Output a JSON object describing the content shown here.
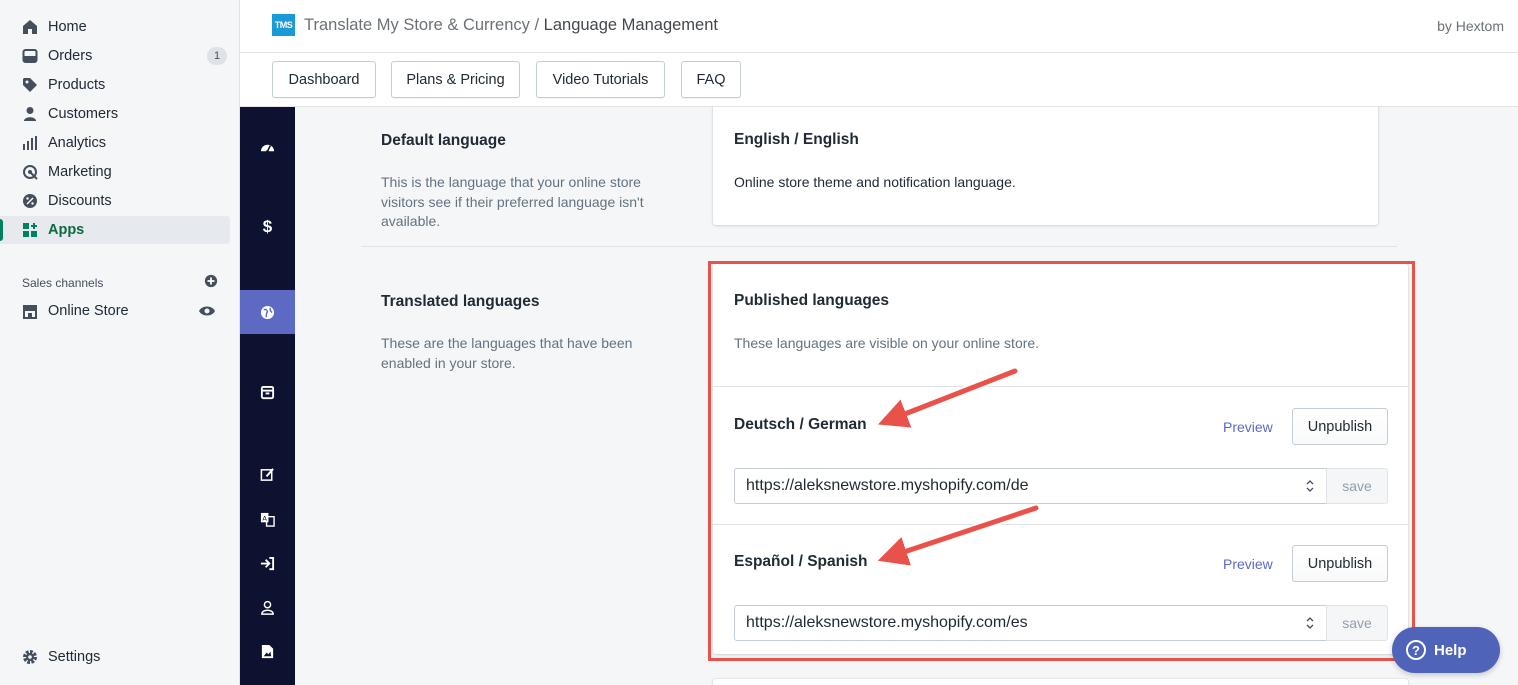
{
  "nav": {
    "items": [
      {
        "label": "Home",
        "icon": "home-icon"
      },
      {
        "label": "Orders",
        "icon": "orders-icon",
        "badge": "1"
      },
      {
        "label": "Products",
        "icon": "tag-icon"
      },
      {
        "label": "Customers",
        "icon": "person-icon"
      },
      {
        "label": "Analytics",
        "icon": "bar-chart-icon"
      },
      {
        "label": "Marketing",
        "icon": "megaphone-icon"
      },
      {
        "label": "Discounts",
        "icon": "discount-icon"
      },
      {
        "label": "Apps",
        "icon": "apps-icon",
        "active": true
      }
    ],
    "sales_channels_label": "Sales channels",
    "online_store_label": "Online Store",
    "settings_label": "Settings"
  },
  "header": {
    "logo_text": "TMS",
    "app_name": "Translate My Store & Currency",
    "separator": "/",
    "page_name": "Language Management",
    "by": "by Hextom"
  },
  "tabs": [
    "Dashboard",
    "Plans & Pricing",
    "Video Tutorials",
    "FAQ"
  ],
  "app_sidebar_icons": [
    "dashboard-icon",
    "dollar-icon",
    "globe-icon",
    "archive-icon",
    "edit-icon",
    "translate-icon",
    "sign-in-icon",
    "user-icon",
    "image-icon"
  ],
  "default_language": {
    "title": "Default language",
    "description": "This is the language that your online store visitors see if their preferred language isn't available.",
    "card_title": "English / English",
    "card_text": "Online store theme and notification language."
  },
  "translated_languages": {
    "title": "Translated languages",
    "description": "These are the languages that have been enabled in your store.",
    "card_title": "Published languages",
    "card_sub": "These languages are visible on your online store.",
    "languages": [
      {
        "name": "Deutsch / German",
        "preview": "Preview",
        "action": "Unpublish",
        "url": "https://aleksnewstore.myshopify.com/de",
        "save": "save"
      },
      {
        "name": "Español / Spanish",
        "preview": "Preview",
        "action": "Unpublish",
        "url": "https://aleksnewstore.myshopify.com/es",
        "save": "save"
      }
    ]
  },
  "help": {
    "label": "Help"
  },
  "colors": {
    "accent": "#5c6ac4",
    "highlight": "#e8524a",
    "app_sidebar": "#0d1230",
    "help_button": "#4f64b9"
  }
}
